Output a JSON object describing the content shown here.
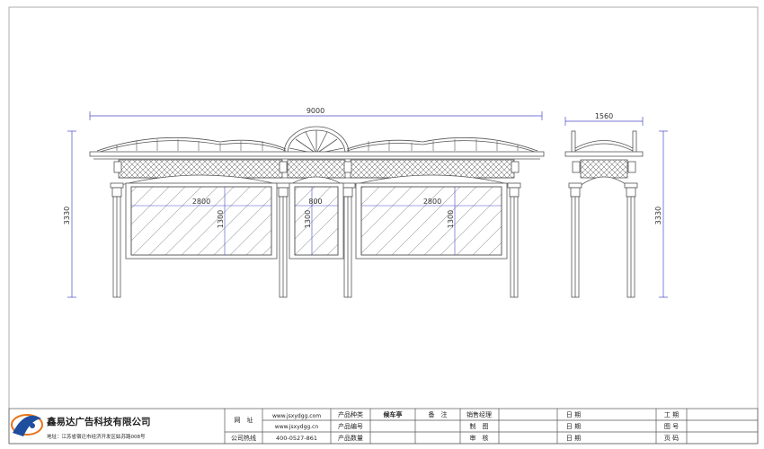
{
  "dimensions": {
    "front_width": "9000",
    "front_height": "3330",
    "side_width": "1560",
    "side_height": "3330",
    "panel_left_width": "2800",
    "panel_left_height": "1300",
    "panel_middle_width": "800",
    "panel_middle_height": "1300",
    "panel_right_width": "2800",
    "panel_right_height": "1300"
  },
  "title_block": {
    "company_name": "鑫易达广告科技有限公司",
    "address": "地址：江苏省宿迁市经济开发区姑苏路008号",
    "website_label": "网　址",
    "website_1": "www.jsxydgg.com",
    "website_2": "www.jsxydgg.cn",
    "hotline_label": "公司热线",
    "hotline": "400-0527-861",
    "product_type_label": "产品种类",
    "product_type": "候车亭",
    "product_no_label": "产品编号",
    "product_qty_label": "产品数量",
    "remarks_label": "备　注",
    "sales_manager_label": "销售经理",
    "drafter_label": "制　图",
    "reviewer_label": "审　核",
    "date_label_1": "日 期",
    "date_label_2": "日 期",
    "date_label_3": "日 期",
    "work_period_label": "工 期",
    "drawing_no_label": "图 号",
    "page_no_label": "页 码"
  },
  "colors": {
    "line": "#555555",
    "dimension": "#4a4ac8",
    "glass_hatch": "#9aa0a8",
    "logo_blue": "#1f4e9e",
    "logo_orange": "#e8731a"
  }
}
